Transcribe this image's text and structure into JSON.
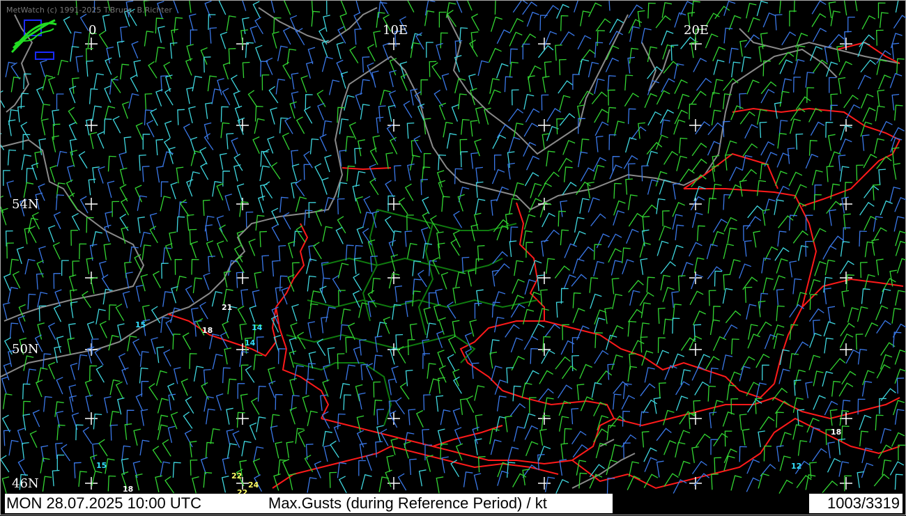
{
  "copyright": "MetWatch  (c) 1991-2025 T.Bruns, B.Richter",
  "longitude_labels": [
    "0",
    "10E",
    "20E"
  ],
  "latitude_labels": [
    "54N",
    "50N",
    "46N"
  ],
  "status": {
    "datetime": "MON 28.07.2025 10:00 UTC",
    "parameter": "Max.Gusts (during Reference Period) / kt",
    "counter": "1003/3319"
  },
  "gust_values": [
    {
      "value": "21",
      "color": "#ffffff"
    },
    {
      "value": "15",
      "color": "#33e0ff"
    },
    {
      "value": "18",
      "color": "#ffffff"
    },
    {
      "value": "14",
      "color": "#33e0ff"
    },
    {
      "value": "14",
      "color": "#33e0ff"
    },
    {
      "value": "15",
      "color": "#33e0ff"
    },
    {
      "value": "18",
      "color": "#ffffff"
    },
    {
      "value": "22",
      "color": "#ffff66"
    },
    {
      "value": "24",
      "color": "#ffff66"
    },
    {
      "value": "22",
      "color": "#ffff66"
    },
    {
      "value": "18",
      "color": "#ffffff"
    },
    {
      "value": "12",
      "color": "#33e0ff"
    }
  ],
  "colors": {
    "coastline": "#8a8a8a",
    "country_border": "#ff1a1a",
    "state_border": "#0f7a0f",
    "wind_blue": "#3a78e8",
    "wind_cyan": "#3fd8e0",
    "wind_green": "#33d633",
    "wind_white": "#ffffff"
  }
}
